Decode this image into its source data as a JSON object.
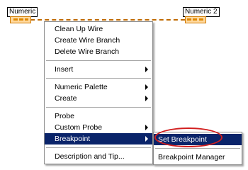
{
  "nodes": {
    "left_label": "Numeric",
    "right_label": "Numeric 2"
  },
  "context_menu": {
    "items": [
      {
        "label": "Clean Up Wire"
      },
      {
        "label": "Create Wire Branch"
      },
      {
        "label": "Delete Wire Branch"
      },
      {
        "label": "Insert"
      },
      {
        "label": "Numeric Palette"
      },
      {
        "label": "Create"
      },
      {
        "label": "Probe"
      },
      {
        "label": "Custom Probe"
      },
      {
        "label": "Breakpoint",
        "highlighted": true
      },
      {
        "label": "Description and Tip..."
      }
    ]
  },
  "submenu": {
    "items": [
      {
        "label": "Set Breakpoint",
        "highlighted": true,
        "circled": true
      },
      {
        "label": "Breakpoint Manager"
      }
    ]
  },
  "colors": {
    "highlight": "#0a246a",
    "wire": "#c06a00",
    "circle": "#d21f1f"
  }
}
